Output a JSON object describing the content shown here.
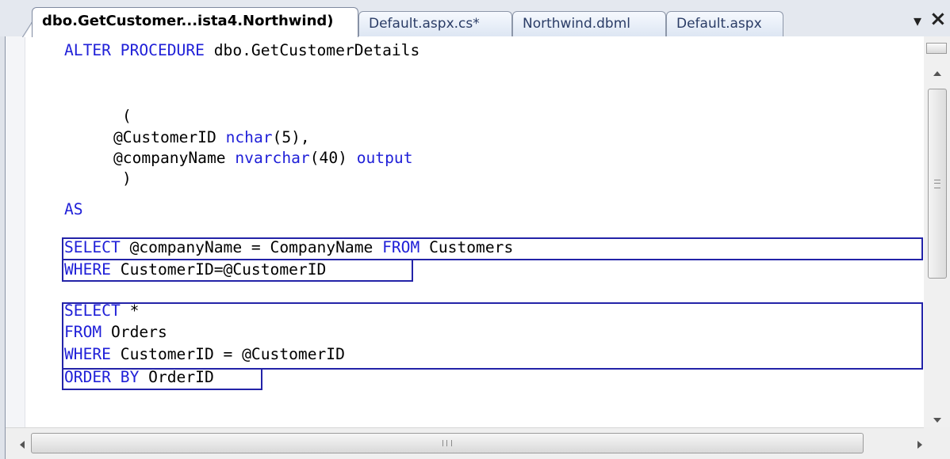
{
  "tabs": [
    {
      "label": "dbo.GetCustomer...ista4.Northwind)",
      "active": true
    },
    {
      "label": "Default.aspx.cs*",
      "active": false
    },
    {
      "label": "Northwind.dbml",
      "active": false
    },
    {
      "label": "Default.aspx",
      "active": false
    }
  ],
  "tabstrip": {
    "dropdown_icon": "chevron-down-icon",
    "close_icon": "close-icon",
    "dropdown_glyph": "▾",
    "close_glyph": "×"
  },
  "editor": {
    "language": "T-SQL",
    "colors": {
      "keyword": "#2020d8",
      "text": "#000000",
      "selection_box": "#2323a8"
    },
    "lines": [
      {
        "segments": [
          {
            "t": "ALTER PROCEDURE",
            "kw": true
          },
          {
            "t": " dbo.GetCustomerDetails",
            "kw": false
          }
        ]
      },
      {
        "segments": [
          {
            "t": "(",
            "kw": false
          }
        ]
      },
      {
        "segments": [
          {
            "t": "@CustomerID ",
            "kw": false
          },
          {
            "t": "nchar",
            "kw": true
          },
          {
            "t": "(5),",
            "kw": false
          }
        ]
      },
      {
        "segments": [
          {
            "t": "@companyName ",
            "kw": false
          },
          {
            "t": "nvarchar",
            "kw": true
          },
          {
            "t": "(40) ",
            "kw": false
          },
          {
            "t": "output",
            "kw": true
          }
        ]
      },
      {
        "segments": [
          {
            "t": ")",
            "kw": false
          }
        ]
      },
      {
        "segments": [
          {
            "t": "AS",
            "kw": true
          }
        ]
      },
      {
        "segments": [
          {
            "t": "SELECT",
            "kw": true
          },
          {
            "t": " @companyName = CompanyName ",
            "kw": false
          },
          {
            "t": "FROM",
            "kw": true
          },
          {
            "t": " Customers",
            "kw": false
          }
        ]
      },
      {
        "segments": [
          {
            "t": "WHERE",
            "kw": true
          },
          {
            "t": " CustomerID=@CustomerID",
            "kw": false
          }
        ]
      },
      {
        "segments": [
          {
            "t": "SELECT",
            "kw": true
          },
          {
            "t": " *",
            "kw": false
          }
        ]
      },
      {
        "segments": [
          {
            "t": "FROM",
            "kw": true
          },
          {
            "t": " Orders",
            "kw": false
          }
        ]
      },
      {
        "segments": [
          {
            "t": "WHERE",
            "kw": true
          },
          {
            "t": " CustomerID = @CustomerID",
            "kw": false
          }
        ]
      },
      {
        "segments": [
          {
            "t": "ORDER BY",
            "kw": true
          },
          {
            "t": " OrderID",
            "kw": false
          }
        ]
      }
    ]
  },
  "scrollbars": {
    "vertical": {
      "up_icon": "arrow-up-icon",
      "down_icon": "arrow-down-icon"
    },
    "horizontal": {
      "left_icon": "arrow-left-icon",
      "right_icon": "arrow-right-icon"
    }
  }
}
